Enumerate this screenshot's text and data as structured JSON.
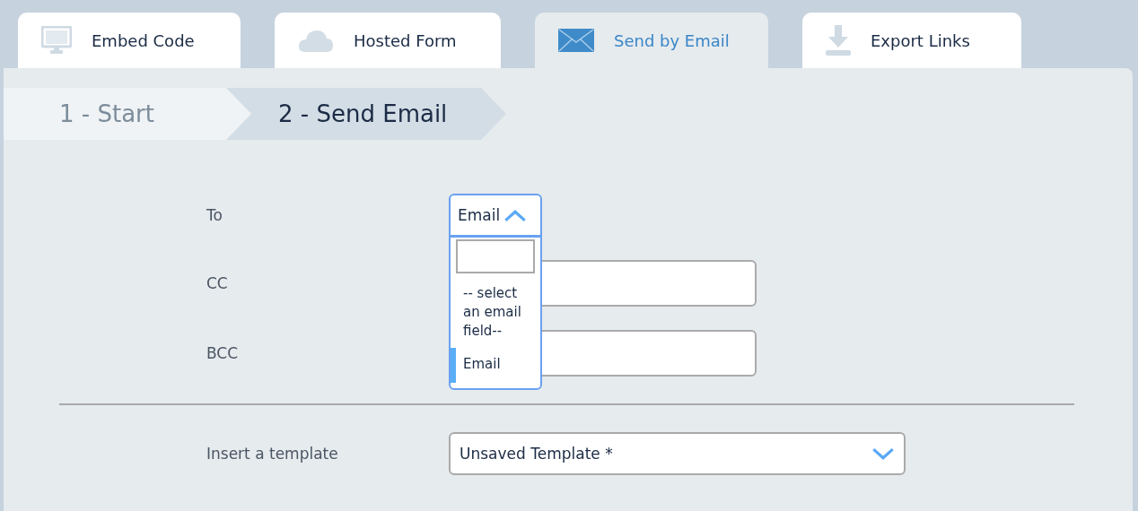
{
  "tabs": [
    {
      "label": "Embed Code",
      "selected": false
    },
    {
      "label": "Hosted Form",
      "selected": false
    },
    {
      "label": "Send by Email",
      "selected": true
    },
    {
      "label": "Export Links",
      "selected": false
    }
  ],
  "steps": [
    {
      "label": "1 - Start",
      "selected": false
    },
    {
      "label": "2 - Send Email",
      "selected": true
    }
  ],
  "fields": [
    {
      "label": "To",
      "kind": "select",
      "value": "Email",
      "expanded": true,
      "options": [
        {
          "label": "-- select an email field--",
          "selected": false
        },
        {
          "label": "Email",
          "selected": true
        }
      ]
    },
    {
      "label": "CC",
      "kind": "text"
    },
    {
      "label": "BCC",
      "kind": "text"
    }
  ],
  "template": {
    "label": "Insert a template",
    "value": "Unsaved Template *",
    "expanded": false
  }
}
